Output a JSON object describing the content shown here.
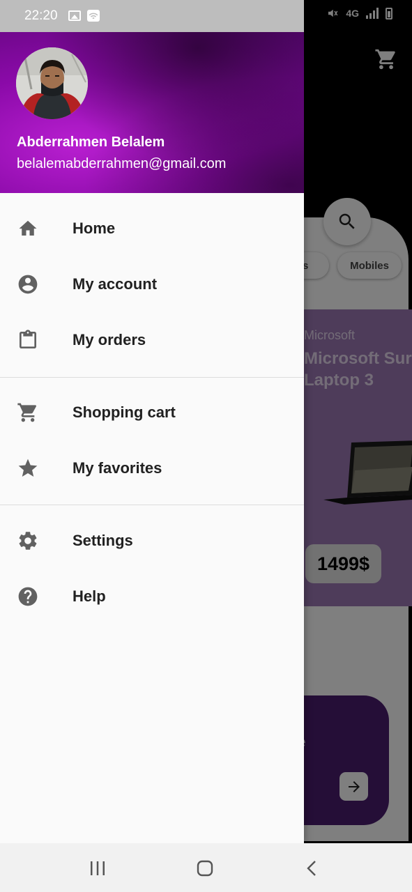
{
  "status_bar": {
    "time": "22:20",
    "icons": [
      "image-icon",
      "wifi-calling-icon",
      "mute-vibrate-icon",
      "4g-data-icon",
      "signal-icon",
      "battery-icon"
    ],
    "network_label": "4G"
  },
  "drawer_header": {
    "user_name": "Abderrahmen Belalem",
    "user_email": "belalemabderrahmen@gmail.com",
    "background_color": "#8a0aa8"
  },
  "drawer_menu": {
    "groups": [
      {
        "items": [
          {
            "label": "Home",
            "icon": "home-icon"
          },
          {
            "label": "My account",
            "icon": "account-circle-icon"
          },
          {
            "label": "My orders",
            "icon": "clipboard-icon"
          }
        ]
      },
      {
        "items": [
          {
            "label": "Shopping cart",
            "icon": "cart-icon"
          },
          {
            "label": "My favorites",
            "icon": "star-icon"
          }
        ]
      },
      {
        "items": [
          {
            "label": "Settings",
            "icon": "gear-icon"
          },
          {
            "label": "Help",
            "icon": "help-circle-icon"
          }
        ]
      }
    ],
    "icon_color": "#616161"
  },
  "background_app": {
    "categories": [
      "PC's",
      "Mobiles"
    ],
    "product": {
      "brand": "Microsoft",
      "name_line1": "Microsoft Surface",
      "name_line2": "Laptop 3",
      "price": "1499$",
      "card_color": "#9c78b5"
    },
    "promo": {
      "text": "ce",
      "card_color": "#4a1d6e"
    }
  },
  "nav_bar": {
    "buttons": [
      "recent-apps-icon",
      "home-circle-icon",
      "back-icon"
    ]
  }
}
